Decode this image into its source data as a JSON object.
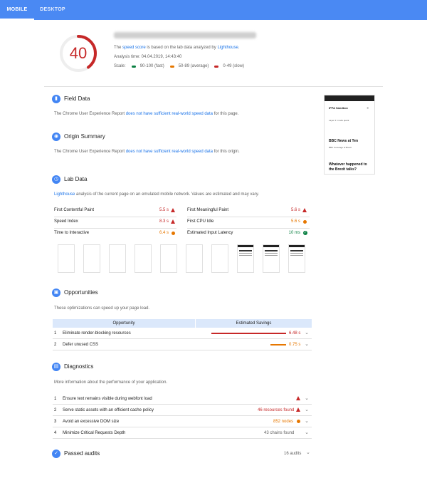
{
  "tabs": {
    "mobile": "MOBILE",
    "desktop": "DESKTOP"
  },
  "score": {
    "value": "40",
    "fraction": 0.4,
    "color": "#c62828"
  },
  "header": {
    "speed_prefix": "The ",
    "speed_link": "speed score",
    "speed_mid": " is based on the lab data analyzed by ",
    "lighthouse_link": "Lighthouse",
    "speed_end": ".",
    "analysis_time": "Analysis time: 04.04.2019, 14:43:40",
    "scale_label": "Scale:",
    "scale_fast": "90-100 (fast)",
    "scale_average": "50-89 (average)",
    "scale_slow": "0-49 (slow)",
    "colors": {
      "fast": "#0b8043",
      "average": "#e67700",
      "slow": "#c62828"
    }
  },
  "field_data": {
    "title": "Field Data",
    "desc_prefix": "The Chrome User Experience Report ",
    "desc_link": "does not have sufficient real-world speed data",
    "desc_end": " for this page."
  },
  "origin_summary": {
    "title": "Origin Summary",
    "desc_prefix": "The Chrome User Experience Report ",
    "desc_link": "does not have sufficient real-world speed data",
    "desc_end": " for this origin."
  },
  "lab_data": {
    "title": "Lab Data",
    "desc_link": "Lighthouse",
    "desc_rest": " analysis of the current page on an emulated mobile network. Values are estimated and may vary.",
    "metrics": [
      {
        "label": "First Contentful Paint",
        "value": "5.5 s"
      },
      {
        "label": "First Meaningful Paint",
        "value": "5.6 s"
      },
      {
        "label": "Speed Index",
        "value": "8.3 s"
      },
      {
        "label": "First CPU Idle",
        "value": "5.6 s"
      },
      {
        "label": "Time to Interactive",
        "value": "6.4 s"
      },
      {
        "label": "Estimated Input Latency",
        "value": "10 ms"
      }
    ]
  },
  "phone_preview": {
    "site": "IPPA Sandbox",
    "menu": "≡",
    "line1": "Layer 4 / mode quark",
    "headline1": "BBC News at Ten",
    "line2": "BBC Coverage of Brexit",
    "headline2": "Whatever happened to",
    "headline2b": "the Brexit talks?"
  },
  "opportunities": {
    "title": "Opportunities",
    "desc": "These optimizations can speed up your page load.",
    "col_opportunity": "Opportunity",
    "col_savings": "Estimated Savings",
    "rows": [
      {
        "n": "1",
        "label": "Eliminate render-blocking resources",
        "value": "6.48 s",
        "bar_fraction": 0.95
      },
      {
        "n": "2",
        "label": "Defer unused CSS",
        "value": "0.75 s",
        "bar_fraction": 0.2
      }
    ]
  },
  "diagnostics": {
    "title": "Diagnostics",
    "desc": "More information about the performance of your application.",
    "rows": [
      {
        "n": "1",
        "label": "Ensure text remains visible during webfont load",
        "value": ""
      },
      {
        "n": "2",
        "label": "Serve static assets with an efficient cache policy",
        "value": "46 resources found"
      },
      {
        "n": "3",
        "label": "Avoid an excessive DOM size",
        "value": "852 nodes"
      },
      {
        "n": "4",
        "label": "Minimize Critical Requests Depth",
        "value": "43 chains found"
      }
    ]
  },
  "passed": {
    "title": "Passed audits",
    "count": "16 audits"
  }
}
